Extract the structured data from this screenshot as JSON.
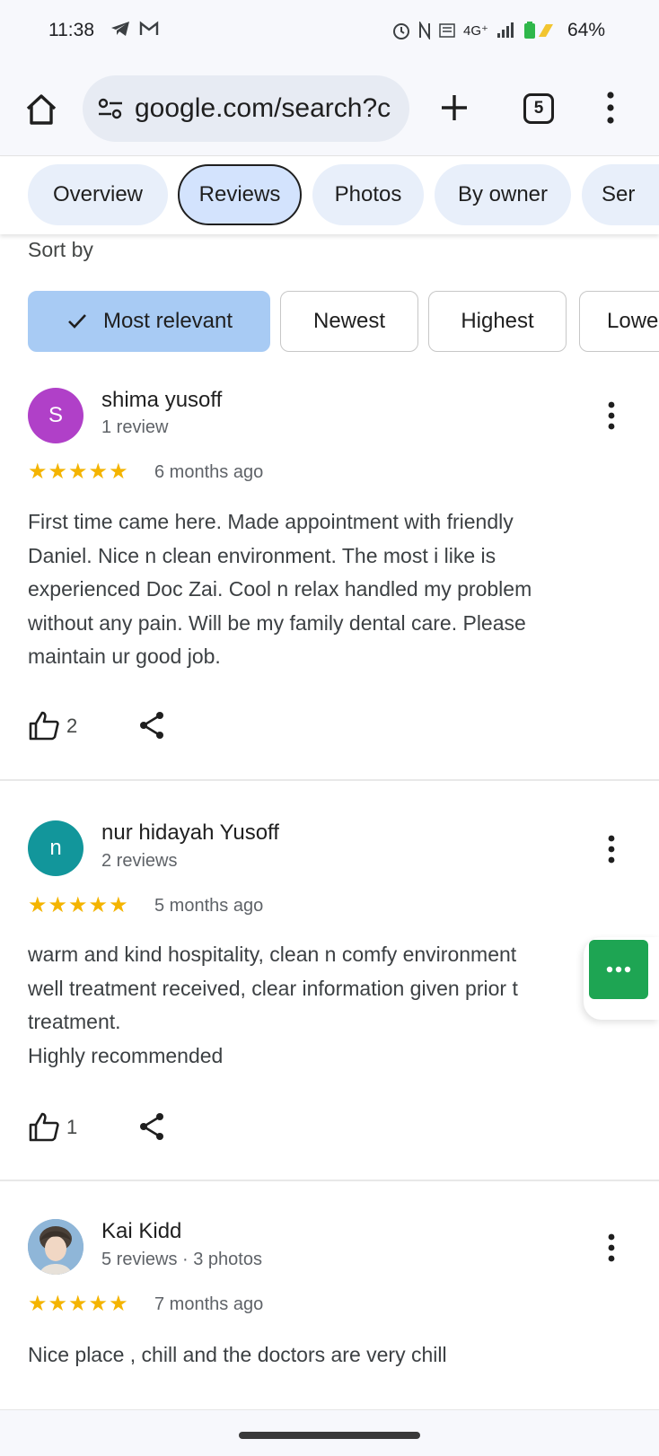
{
  "status_bar": {
    "time": "11:38",
    "network": "4G⁺",
    "battery": "64%"
  },
  "browser": {
    "url": "google.com/search?c",
    "tab_count": "5"
  },
  "nav_chips": [
    "Overview",
    "Reviews",
    "Photos",
    "By owner",
    "Ser"
  ],
  "active_chip": "Reviews",
  "sort": {
    "label": "Sort by",
    "options": [
      "Most relevant",
      "Newest",
      "Highest",
      "Lowe"
    ],
    "selected": "Most relevant"
  },
  "reviews": [
    {
      "initial": "S",
      "avatar_color": "#b040c8",
      "name": "shima yusoff",
      "meta": "1 review",
      "stars": "★★★★★",
      "when": "6 months ago",
      "text": "First time came here. Made appointment with friendly\nDaniel. Nice n clean environment. The most i like is\nexperienced Doc Zai. Cool n relax handled my problem\nwithout any pain. Will be my family dental care. Please\nmaintain ur good job.",
      "likes": "2"
    },
    {
      "initial": "n",
      "avatar_color": "#12969b",
      "name": "nur hidayah Yusoff",
      "meta": "2 reviews",
      "stars": "★★★★★",
      "when": "5 months ago",
      "text": "warm and kind hospitality, clean n comfy environment\nwell treatment received, clear information given prior t\ntreatment.\nHighly recommended",
      "likes": "1"
    },
    {
      "initial": "",
      "avatar_color": "#5a7da0",
      "name": "Kai Kidd",
      "meta": "5 reviews · 3 photos",
      "stars": "★★★★★",
      "when": "7 months ago",
      "text": "Nice place , chill and the doctors are very chill",
      "likes": ""
    }
  ],
  "colors": {
    "star": "#f4b400",
    "fab": "#1ea553",
    "active_sort": "#a8cbf4",
    "chip_bg": "#e8effa"
  }
}
